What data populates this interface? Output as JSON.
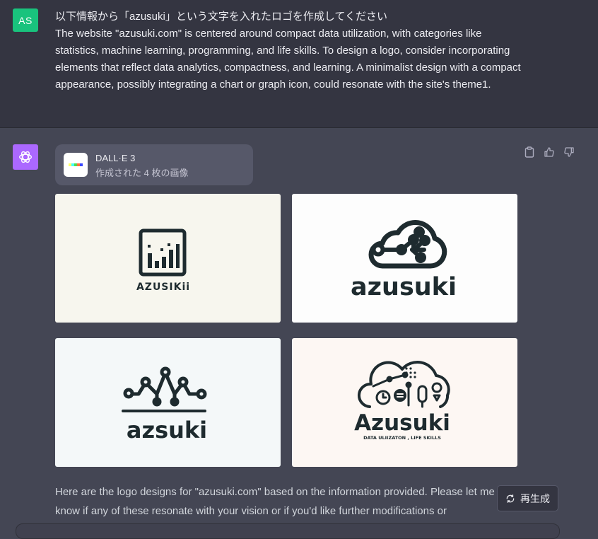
{
  "user": {
    "avatar_initials": "AS",
    "message_lines": [
      "以下情報から「azusuki」という文字を入れたロゴを作成してください",
      "The website \"azusuki.com\" is centered around compact data utilization, with categories like statistics, machine learning, programming, and life skills. To design a logo, consider incorporating elements that reflect data analytics, compactness, and learning. A minimalist design with a compact appearance, possibly integrating a chart or graph icon, could resonate with the site's theme1."
    ]
  },
  "assistant": {
    "avatar_icon": "openai-logo-icon",
    "tool_card": {
      "title": "DALL·E 3",
      "subtitle": "作成された 4 枚の画像",
      "icon": "dalle-icon"
    },
    "action_icons": [
      "clipboard-icon",
      "thumbs-up-icon",
      "thumbs-down-icon"
    ],
    "images": [
      {
        "logo_text": "AZUSIKii"
      },
      {
        "logo_text": "azusuki"
      },
      {
        "logo_text": "azsuki"
      },
      {
        "logo_text": "Azusuki",
        "tagline": "DATA ULIIZATON , LIFE SKILLS"
      }
    ],
    "reply_text": "Here are the logo designs for \"azusuki.com\" based on the information provided. Please let me know if any of these resonate with your vision or if you'd like further modifications or",
    "regenerate_label": "再生成"
  },
  "colors": {
    "user_bg": "#343541",
    "assistant_bg": "#444654",
    "user_avatar": "#19c37d",
    "assistant_avatar": "#ab68ff",
    "logo_ink": "#1e2b2f"
  }
}
